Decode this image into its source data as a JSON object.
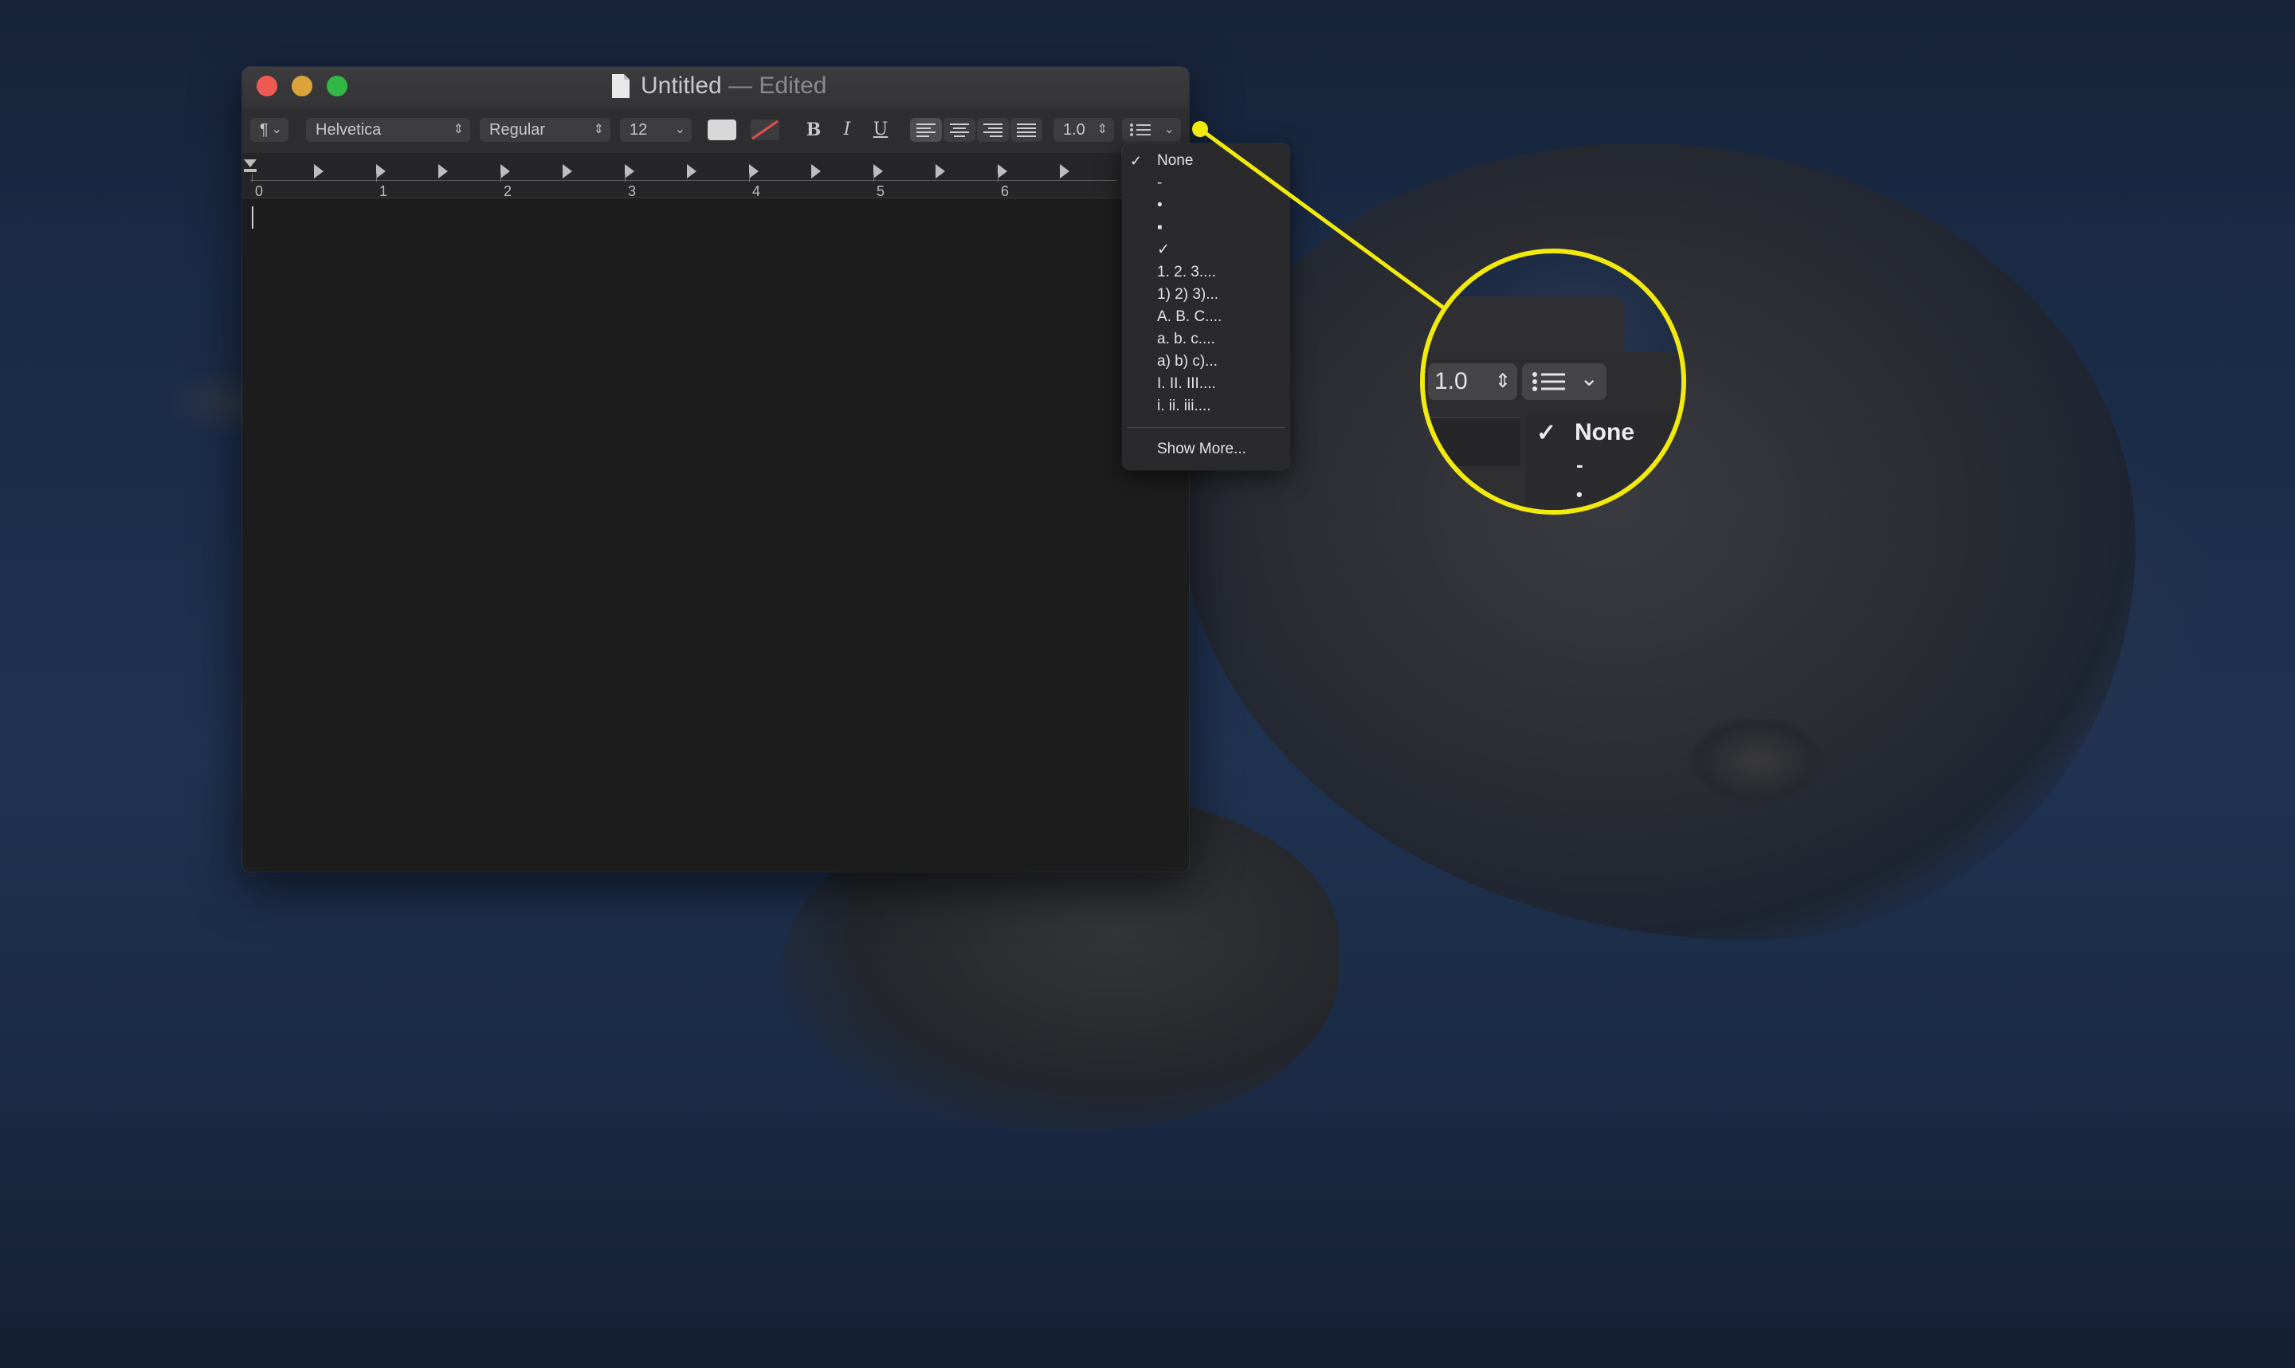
{
  "window": {
    "title": "Untitled",
    "title_separator": "—",
    "title_status": "Edited"
  },
  "toolbar": {
    "paragraph_style_symbol": "¶",
    "font_family": "Helvetica",
    "font_style": "Regular",
    "font_size": "12",
    "bold_label": "B",
    "italic_label": "I",
    "underline_label": "U",
    "line_spacing": "1.0",
    "text_color": "#d8d8d8",
    "highlight_color": "none"
  },
  "ruler": {
    "numbers": [
      "0",
      "1",
      "2",
      "3",
      "4",
      "5",
      "6"
    ]
  },
  "list_menu": {
    "items": [
      {
        "label": "None",
        "checked": true
      },
      {
        "label": "-",
        "checked": false
      },
      {
        "label": "•",
        "checked": false
      },
      {
        "label": "▪",
        "checked": false
      },
      {
        "label": "✓",
        "checked": false
      },
      {
        "label": "1.  2.  3....",
        "checked": false
      },
      {
        "label": "1)  2)  3)...",
        "checked": false
      },
      {
        "label": "A.  B.  C....",
        "checked": false
      },
      {
        "label": "a.  b.  c....",
        "checked": false
      },
      {
        "label": "a)  b)  c)...",
        "checked": false
      },
      {
        "label": "I.  II.  III....",
        "checked": false
      },
      {
        "label": "i.  ii.  iii....",
        "checked": false
      }
    ],
    "show_more": "Show More..."
  },
  "callout": {
    "spacing_value": "1.0",
    "selected_item": "None",
    "second_item": "-",
    "third_item": "•",
    "accent_color": "#f2ea0d"
  }
}
